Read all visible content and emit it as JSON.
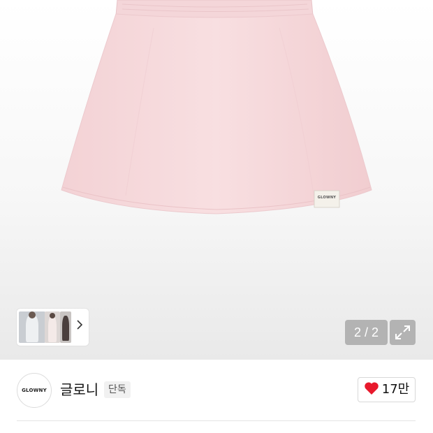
{
  "gallery": {
    "product_image": "pink-mini-skirt",
    "tag_text": "GLOWNY",
    "thumbnails": [
      "model-photo-1",
      "model-photo-2",
      "model-photo-3"
    ],
    "next_icon": "chevron-right-icon",
    "pager": "2 / 2",
    "expand_icon": "expand-icon"
  },
  "brand": {
    "logo_text": "GLOWNY",
    "name": "글로니",
    "badge": "단독",
    "likes": "17만",
    "heart_icon": "heart-icon",
    "heart_color": "#e8192c"
  },
  "colors": {
    "skirt": "#f6d8da",
    "overlay": "#a0a0a0"
  }
}
